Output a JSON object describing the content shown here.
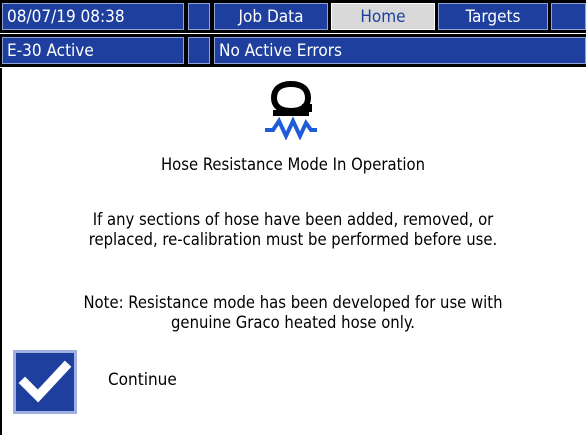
{
  "header": {
    "datetime": "08/07/19 08:38",
    "tabs": [
      {
        "label": "Job Data",
        "selected": false
      },
      {
        "label": "Home",
        "selected": true
      },
      {
        "label": "Targets",
        "selected": false
      }
    ],
    "status": "E-30 Active",
    "errors": "No Active Errors"
  },
  "message": {
    "icon": "hose-resistance-icon",
    "title": "Hose Resistance Mode In Operation",
    "warning_line1": "If any sections of hose have been added, removed, or",
    "warning_line2": "replaced, re-calibration must be performed before use.",
    "note_line1": "Note: Resistance mode has been developed for use with",
    "note_line2": "genuine Graco heated hose only."
  },
  "continue": {
    "label": "Continue",
    "icon": "checkmark-icon"
  },
  "colors": {
    "header_blue": "#1e3f9e",
    "selected_tab_bg": "#d9d9d9",
    "icon_blue": "#1f5bd6"
  }
}
